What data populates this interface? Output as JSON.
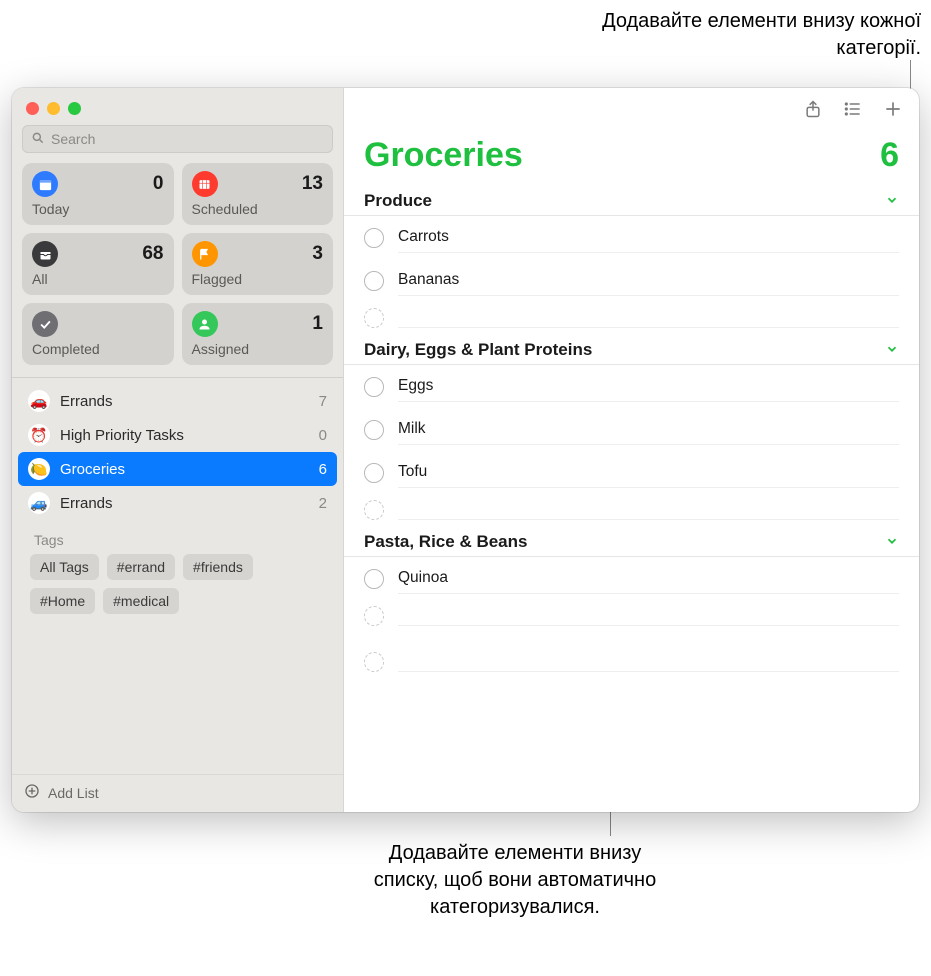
{
  "callouts": {
    "top": "Додавайте елементи внизу кожної категорії.",
    "bottom": "Додавайте елементи внизу списку, щоб вони автоматично категоризувалися."
  },
  "sidebar": {
    "search_placeholder": "Search",
    "smart": [
      {
        "label": "Today",
        "count": "0",
        "color": "#2f7bff",
        "icon": "calendar"
      },
      {
        "label": "Scheduled",
        "count": "13",
        "color": "#ff3b30",
        "icon": "calendar-grid"
      },
      {
        "label": "All",
        "count": "68",
        "color": "#3a3a3c",
        "icon": "tray"
      },
      {
        "label": "Flagged",
        "count": "3",
        "color": "#ff9500",
        "icon": "flag"
      },
      {
        "label": "Completed",
        "count": "",
        "color": "#6e6e73",
        "icon": "check"
      },
      {
        "label": "Assigned",
        "count": "1",
        "color": "#34c759",
        "icon": "person"
      }
    ],
    "lists": [
      {
        "emoji": "🚗",
        "label": "Errands",
        "count": "7",
        "selected": false
      },
      {
        "emoji": "⏰",
        "label": "High Priority Tasks",
        "count": "0",
        "selected": false
      },
      {
        "emoji": "🍋",
        "label": "Groceries",
        "count": "6",
        "selected": true
      },
      {
        "emoji": "🚙",
        "label": "Errands",
        "count": "2",
        "selected": false
      }
    ],
    "tags_header": "Tags",
    "tags": [
      "All Tags",
      "#errand",
      "#friends",
      "#Home",
      "#medical"
    ],
    "add_list": "Add List"
  },
  "main": {
    "title": "Groceries",
    "count": "6",
    "sections": [
      {
        "title": "Produce",
        "items": [
          "Carrots",
          "Bananas"
        ]
      },
      {
        "title": "Dairy, Eggs & Plant Proteins",
        "items": [
          "Eggs",
          "Milk",
          "Tofu"
        ]
      },
      {
        "title": "Pasta, Rice & Beans",
        "items": [
          "Quinoa"
        ]
      }
    ]
  }
}
